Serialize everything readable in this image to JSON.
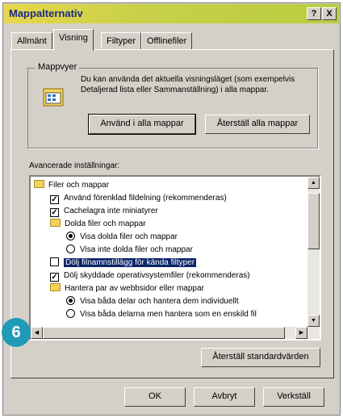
{
  "window": {
    "title": "Mappalternativ",
    "help_glyph": "?",
    "close_glyph": "X"
  },
  "tabs": [
    "Allmänt",
    "Visning",
    "Filtyper",
    "Offlinefiler"
  ],
  "folder_views": {
    "group_label": "Mappvyer",
    "description": "Du kan använda det aktuella visningsläget (som exempelvis Detaljerad lista eller Sammanställning) i alla mappar.",
    "apply_all_label": "Använd i alla mappar",
    "reset_all_label": "Återställ alla mappar"
  },
  "advanced": {
    "label": "Avancerade inställningar:",
    "items": [
      {
        "type": "folder",
        "text": "Filer och mappar",
        "indent": 0
      },
      {
        "type": "check",
        "text": "Använd förenklad fildelning (rekommenderas)",
        "checked": true,
        "indent": 1
      },
      {
        "type": "check",
        "text": "Cachelagra inte miniatyrer",
        "checked": true,
        "indent": 1
      },
      {
        "type": "folder",
        "text": "Dolda filer och mappar",
        "indent": 1
      },
      {
        "type": "radio",
        "text": "Visa dolda filer och mappar",
        "checked": true,
        "indent": 2
      },
      {
        "type": "radio",
        "text": "Visa inte dolda filer och mappar",
        "checked": false,
        "indent": 2
      },
      {
        "type": "check",
        "text": "Dölj filnamnstillägg för kända filtyper",
        "checked": false,
        "indent": 1,
        "selected": true
      },
      {
        "type": "check",
        "text": "Dölj skyddade operativsystemfiler (rekommenderas)",
        "checked": true,
        "indent": 1
      },
      {
        "type": "folder",
        "text": "Hantera par av webbsidor eller mappar",
        "indent": 1
      },
      {
        "type": "radio",
        "text": "Visa båda delar och hantera dem individuellt",
        "checked": true,
        "indent": 2
      },
      {
        "type": "radio",
        "text": "Visa båda delarna men hantera som en enskild fil",
        "checked": false,
        "indent": 2
      }
    ],
    "restore_defaults_label": "Återställ standardvärden"
  },
  "footer": {
    "ok": "OK",
    "cancel": "Avbryt",
    "apply": "Verkställ"
  },
  "step_badge": "6"
}
